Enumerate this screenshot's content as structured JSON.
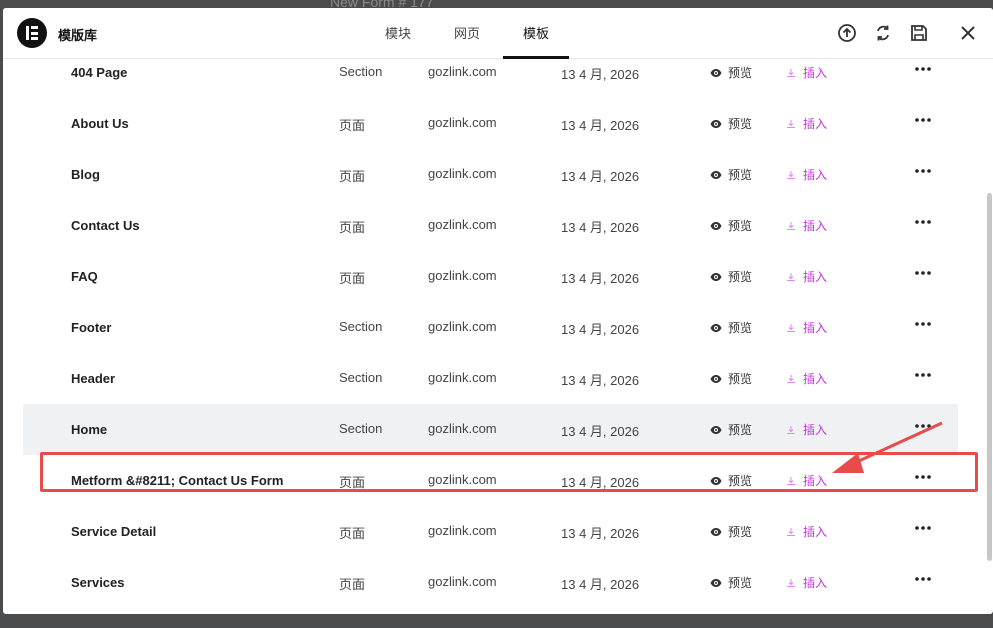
{
  "backdrop": {
    "title": "New Form # 177"
  },
  "header": {
    "title": "模版库",
    "tabs": [
      {
        "label": "模块",
        "active": false
      },
      {
        "label": "网页",
        "active": false
      },
      {
        "label": "模板",
        "active": true
      }
    ]
  },
  "templates": [
    {
      "title": "404 Page",
      "type": "Section",
      "author": "gozlink.com",
      "date": "13 4 月, 2026",
      "preview": "预览",
      "insert": "插入"
    },
    {
      "title": "About Us",
      "type": "页面",
      "author": "gozlink.com",
      "date": "13 4 月, 2026",
      "preview": "预览",
      "insert": "插入"
    },
    {
      "title": "Blog",
      "type": "页面",
      "author": "gozlink.com",
      "date": "13 4 月, 2026",
      "preview": "预览",
      "insert": "插入"
    },
    {
      "title": "Contact Us",
      "type": "页面",
      "author": "gozlink.com",
      "date": "13 4 月, 2026",
      "preview": "预览",
      "insert": "插入"
    },
    {
      "title": "FAQ",
      "type": "页面",
      "author": "gozlink.com",
      "date": "13 4 月, 2026",
      "preview": "预览",
      "insert": "插入"
    },
    {
      "title": "Footer",
      "type": "Section",
      "author": "gozlink.com",
      "date": "13 4 月, 2026",
      "preview": "预览",
      "insert": "插入"
    },
    {
      "title": "Header",
      "type": "Section",
      "author": "gozlink.com",
      "date": "13 4 月, 2026",
      "preview": "预览",
      "insert": "插入"
    },
    {
      "title": "Home",
      "type": "Section",
      "author": "gozlink.com",
      "date": "13 4 月, 2026",
      "preview": "预览",
      "insert": "插入"
    },
    {
      "title": "Metform &#8211; Contact Us Form",
      "type": "页面",
      "author": "gozlink.com",
      "date": "13 4 月, 2026",
      "preview": "预览",
      "insert": "插入"
    },
    {
      "title": "Service Detail",
      "type": "页面",
      "author": "gozlink.com",
      "date": "13 4 月, 2026",
      "preview": "预览",
      "insert": "插入"
    },
    {
      "title": "Services",
      "type": "页面",
      "author": "gozlink.com",
      "date": "13 4 月, 2026",
      "preview": "预览",
      "insert": "插入"
    }
  ],
  "colors": {
    "accent": "#c036d8",
    "annotation": "#e84b4b",
    "highlight_row": "#f0f1f3"
  }
}
